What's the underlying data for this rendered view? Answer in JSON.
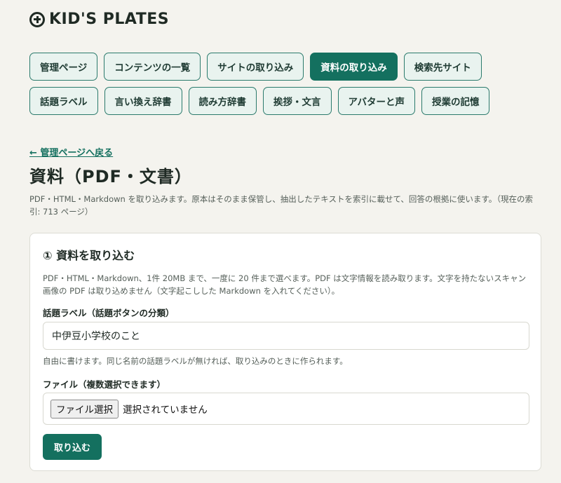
{
  "logo": {
    "text": "KID'S PLATES",
    "icon": "plus-circle-icon"
  },
  "nav": {
    "row1": [
      {
        "label": "管理ページ",
        "active": false
      },
      {
        "label": "コンテンツの一覧",
        "active": false
      },
      {
        "label": "サイトの取り込み",
        "active": false
      },
      {
        "label": "資料の取り込み",
        "active": true
      },
      {
        "label": "検索先サイト",
        "active": false
      }
    ],
    "row2": [
      {
        "label": "話題ラベル",
        "active": false
      },
      {
        "label": "言い換え辞書",
        "active": false
      },
      {
        "label": "読み方辞書",
        "active": false
      },
      {
        "label": "挨拶・文言",
        "active": false
      },
      {
        "label": "アバターと声",
        "active": false
      },
      {
        "label": "授業の記憶",
        "active": false
      }
    ]
  },
  "back_link": "← 管理ページへ戻る",
  "page": {
    "title": "資料（PDF・文書）",
    "description": "PDF・HTML・Markdown を取り込みます。原本はそのまま保管し、抽出したテキストを索引に載せて、回答の根拠に使います。（現在の索引: 713 ページ）"
  },
  "card": {
    "title": "① 資料を取り込む",
    "description": "PDF・HTML・Markdown、1件 20MB まで、一度に 20 件まで選べます。PDF は文字情報を読み取ります。文字を持たないスキャン画像の PDF は取り込めません（文字起こしした Markdown を入れてください）。",
    "topic_label": "話題ラベル（話題ボタンの分類）",
    "topic_value": "中伊豆小学校のこと",
    "topic_hint": "自由に書けます。同じ名前の話題ラベルが無ければ、取り込みのときに作られます。",
    "file_label": "ファイル（複数選択できます）",
    "file_button": "ファイル選択",
    "file_status": "選択されていません",
    "submit": "取り込む"
  },
  "colors": {
    "accent": "#14705f",
    "background": "#f4f3ee",
    "nav_bg": "#e9f3ef"
  }
}
